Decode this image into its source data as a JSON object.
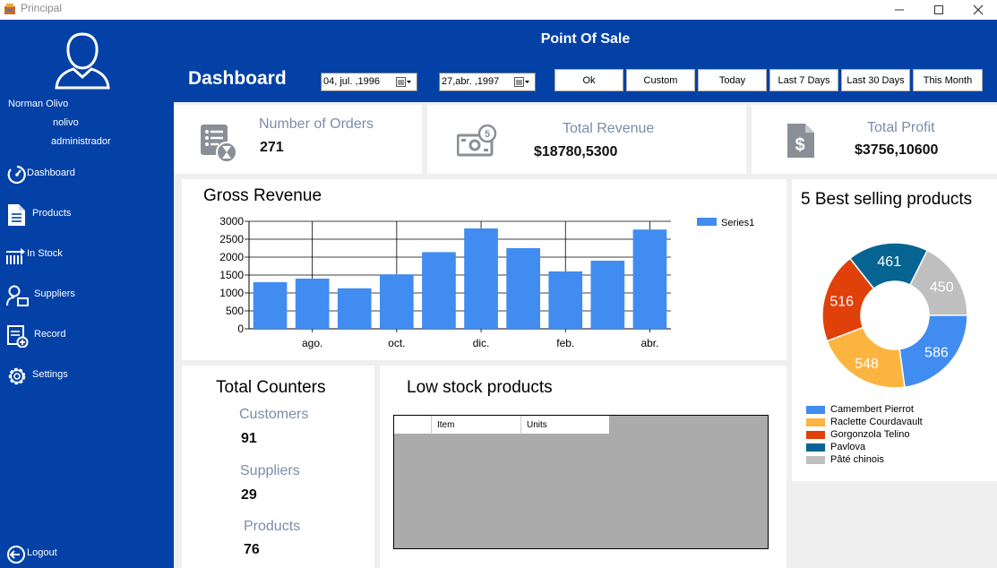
{
  "window": {
    "title": "Principal"
  },
  "user": {
    "name": "Norman Olivo",
    "login": "nolivo",
    "role": "administrador"
  },
  "nav": [
    {
      "label": "Dashboard",
      "icon": "dashboard-gauge-icon"
    },
    {
      "label": "Products",
      "icon": "document-icon"
    },
    {
      "label": "In Stock",
      "icon": "stock-arrow-icon"
    },
    {
      "label": "Suppliers",
      "icon": "supplier-user-icon"
    },
    {
      "label": "Record",
      "icon": "record-add-icon"
    },
    {
      "label": "Settings",
      "icon": "gear-icon"
    }
  ],
  "logout": {
    "label": "Logout",
    "icon": "logout-icon"
  },
  "header": {
    "app_title": "Point Of Sale",
    "page_title": "Dashboard",
    "start_date": "04, jul.  ,1996",
    "end_date": "27,abr. ,1997",
    "buttons": [
      "Ok",
      "Custom",
      "Today",
      "Last 7 Days",
      "Last 30 Days",
      "This Month"
    ]
  },
  "kpis": {
    "orders": {
      "label": "Number of Orders",
      "value": "271"
    },
    "revenue": {
      "label": "Total Revenue",
      "value": "$18780,5300"
    },
    "profit": {
      "label": "Total Profit",
      "value": "$3756,10600"
    }
  },
  "gross_revenue": {
    "title": "Gross Revenue"
  },
  "best_selling": {
    "title": "5 Best selling products"
  },
  "counters": {
    "title": "Total Counters",
    "customers": {
      "label": "Customers",
      "value": "91"
    },
    "suppliers": {
      "label": "Suppliers",
      "value": "29"
    },
    "products": {
      "label": "Products",
      "value": "76"
    }
  },
  "low_stock": {
    "title": "Low stock products",
    "columns": [
      "Item",
      "Units"
    ]
  },
  "colors": {
    "sidebar": "#0341a7",
    "bar": "#418cf0",
    "kpi_label": "#7b8cab"
  },
  "chart_data": [
    {
      "type": "bar",
      "title": "Gross Revenue",
      "categories": [
        "",
        "ago.",
        "",
        "oct.",
        "",
        "dic.",
        "",
        "feb.",
        "",
        "abr."
      ],
      "series": [
        {
          "name": "Series1",
          "values": [
            1300,
            1400,
            1130,
            1520,
            2140,
            2800,
            2250,
            1600,
            1900,
            2770
          ]
        }
      ],
      "ylim": [
        0,
        3000
      ],
      "yticks": [
        0,
        500,
        1000,
        1500,
        2000,
        2500,
        3000
      ],
      "xlabel": "",
      "ylabel": "",
      "grid": true,
      "legend": "top-right"
    },
    {
      "type": "pie",
      "title": "5 Best selling products",
      "slices": [
        {
          "label": "Camembert Pierrot",
          "value": 586,
          "color": "#418cf0"
        },
        {
          "label": "Raclette Courdavault",
          "value": 548,
          "color": "#fcb441"
        },
        {
          "label": "Gorgonzola Telino",
          "value": 516,
          "color": "#e0400a"
        },
        {
          "label": "Pavlova",
          "value": 461,
          "color": "#056492"
        },
        {
          "label": "Pâté chinois",
          "value": 450,
          "color": "#bfbfbf"
        }
      ],
      "legend": "bottom-left"
    }
  ]
}
